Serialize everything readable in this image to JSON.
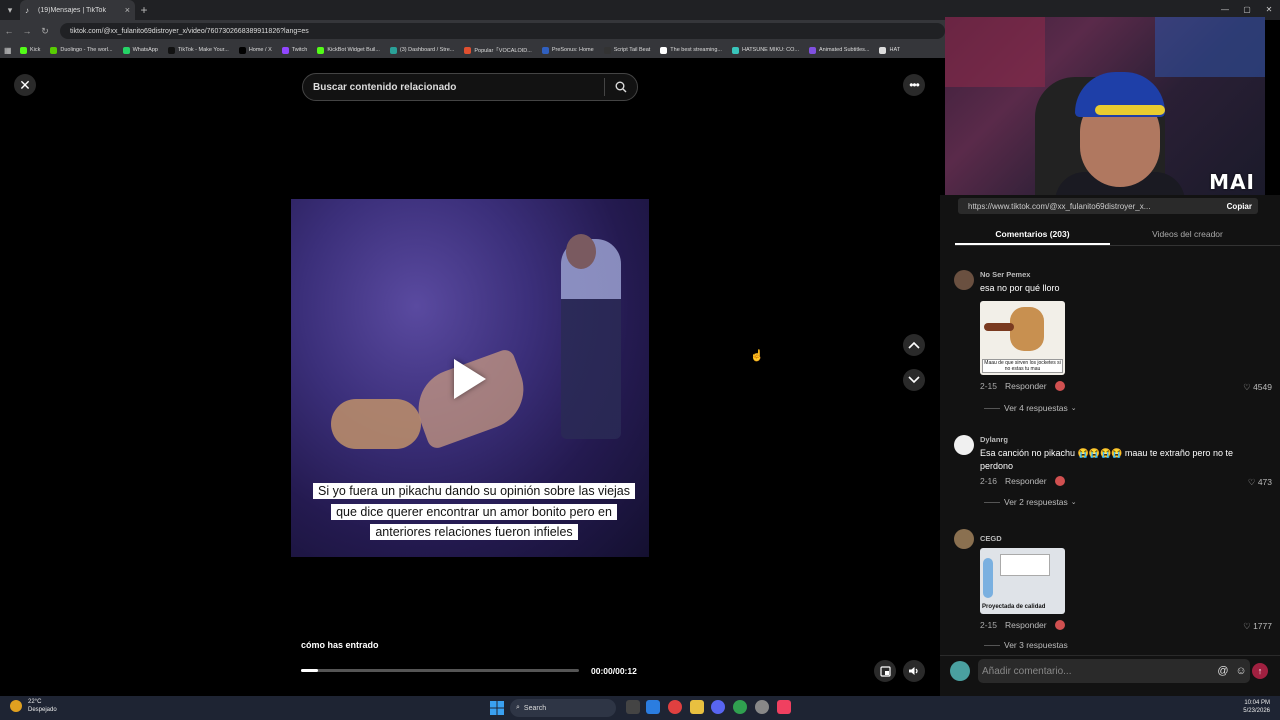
{
  "browser": {
    "tab_title": "(19)Mensajes | TikTok",
    "url": "tiktok.com/@xx_fulanito69distroyer_x/video/7607302668389911826?lang=es",
    "bookmarks": [
      {
        "label": "Kick",
        "color": "#53fc18"
      },
      {
        "label": "Duolingo - The worl...",
        "color": "#58cc02"
      },
      {
        "label": "WhatsApp",
        "color": "#25d366"
      },
      {
        "label": "TikTok - Make Your...",
        "color": "#111111"
      },
      {
        "label": "Home / X",
        "color": "#000000"
      },
      {
        "label": "Twitch",
        "color": "#9146ff"
      },
      {
        "label": "KickBot Widget Buil...",
        "color": "#53fc18"
      },
      {
        "label": "(3) Dashboard / Stre...",
        "color": "#2aa198"
      },
      {
        "label": "Popular「VOCALOID...",
        "color": "#e05030"
      },
      {
        "label": "PreSonus: Home",
        "color": "#3060c0"
      },
      {
        "label": "Script Tail Beat",
        "color": "#333333"
      },
      {
        "label": "The best streaming...",
        "color": "#ffffff"
      },
      {
        "label": "HATSUNE MIKU: CO...",
        "color": "#39c5bb"
      },
      {
        "label": "Animated Subtitles...",
        "color": "#8050e0"
      },
      {
        "label": "HAT",
        "color": "#dddddd"
      }
    ]
  },
  "webcam": {
    "logo_text": "MAI"
  },
  "search": {
    "placeholder": "Buscar contenido relacionado"
  },
  "video": {
    "caption": "Si yo fuera un pikachu dando su opinión sobre las viejas que dice querer encontrar un amor bonito pero en anteriores relaciones fueron infieles",
    "title": "cómo has entrado",
    "time": "00:00/00:12",
    "progress": 0.06
  },
  "panel": {
    "link": "https://www.tiktok.com/@xx_fulanito69distroyer_x...",
    "copy_label": "Copiar",
    "tabs": [
      "Comentarios (203)",
      "Videos del creador"
    ],
    "comments": [
      {
        "user": "No Ser Pemex",
        "text": "esa no por qué lloro",
        "has_image": true,
        "image_caption": "Maau de que sirven los jocketes si no estas tu mau",
        "date": "2-15",
        "reply_label": "Responder",
        "likes": "4549",
        "replies": "Ver 4 respuestas"
      },
      {
        "user": "Dylanrg",
        "text": "Esa canción no pikachu 😭😭😭😭 maau te extraño pero no te perdono",
        "has_image": false,
        "date": "2-16",
        "reply_label": "Responder",
        "likes": "473",
        "replies": "Ver 2 respuestas"
      },
      {
        "user": "CEGD",
        "text": "",
        "has_image": true,
        "image_caption": "Proyectada de calidad",
        "date": "2-15",
        "reply_label": "Responder",
        "likes": "1777",
        "replies": "Ver 3 respuestas"
      }
    ],
    "add_comment_placeholder": "Añadir comentario..."
  },
  "taskbar": {
    "weather_temp": "22°C",
    "weather_desc": "Despejado",
    "search_label": "Search",
    "time": "10:04 PM",
    "date": "5/23/2026"
  }
}
